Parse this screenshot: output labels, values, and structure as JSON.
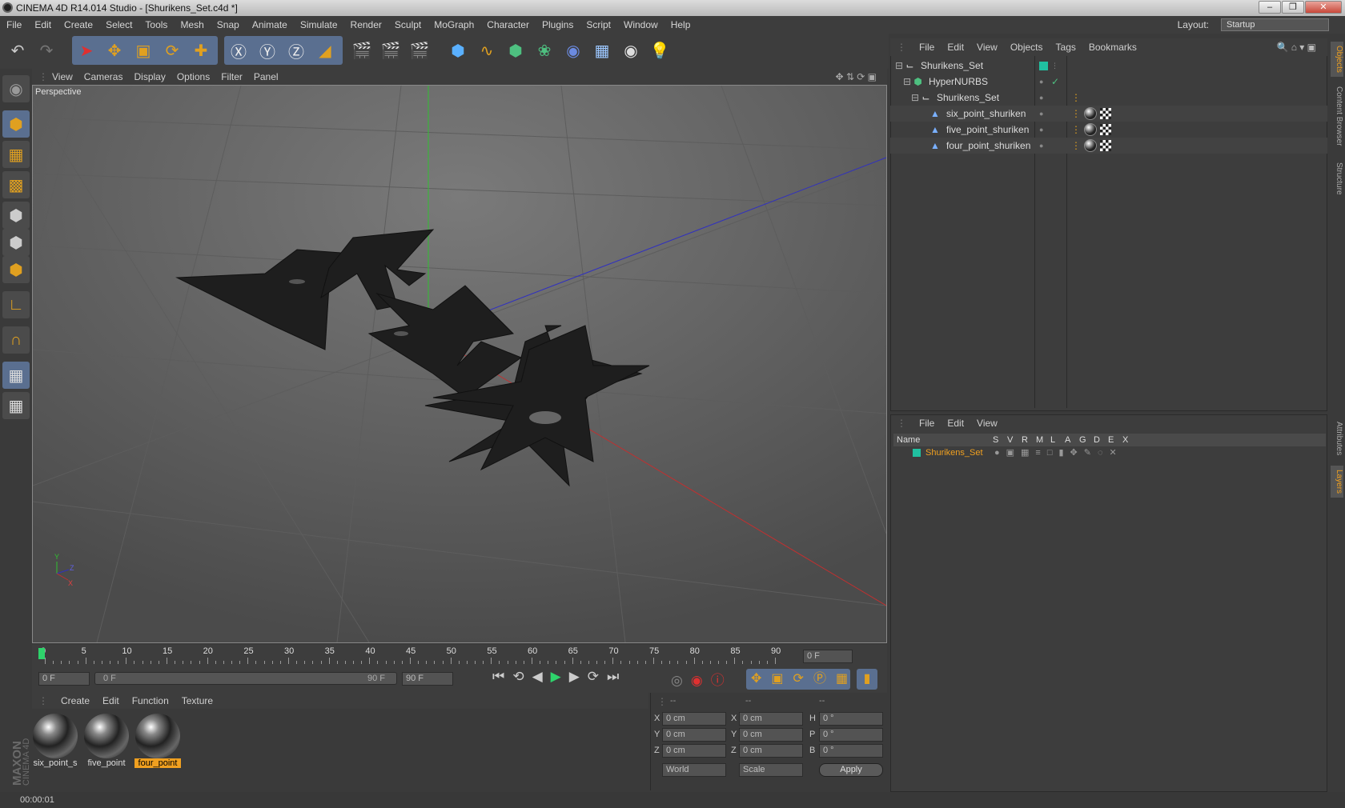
{
  "window": {
    "title": "CINEMA 4D R14.014 Studio - [Shurikens_Set.c4d *]"
  },
  "menu": {
    "items": [
      "File",
      "Edit",
      "Create",
      "Select",
      "Tools",
      "Mesh",
      "Snap",
      "Animate",
      "Simulate",
      "Render",
      "Sculpt",
      "MoGraph",
      "Character",
      "Plugins",
      "Script",
      "Window",
      "Help"
    ],
    "layout_label": "Layout:",
    "layout_value": "Startup"
  },
  "viewport": {
    "menu": [
      "View",
      "Cameras",
      "Display",
      "Options",
      "Filter",
      "Panel"
    ],
    "label": "Perspective"
  },
  "timeline": {
    "ticks": [
      "0",
      "5",
      "10",
      "15",
      "20",
      "25",
      "30",
      "35",
      "40",
      "45",
      "50",
      "55",
      "60",
      "65",
      "70",
      "75",
      "80",
      "85",
      "90"
    ],
    "current": "0 F"
  },
  "transport": {
    "start": "0 F",
    "range_start": "0 F",
    "range_end": "90 F",
    "end": "90 F"
  },
  "materials": {
    "menu": [
      "Create",
      "Edit",
      "Function",
      "Texture"
    ],
    "items": [
      {
        "name": "six_point_s"
      },
      {
        "name": "five_point"
      },
      {
        "name": "four_point"
      }
    ]
  },
  "coords": {
    "headers": [
      "--",
      "--",
      "--"
    ],
    "rows": [
      {
        "axis": "X",
        "pos": "0 cm",
        "axis2": "X",
        "size": "0 cm",
        "rotlbl": "H",
        "rot": "0 °"
      },
      {
        "axis": "Y",
        "pos": "0 cm",
        "axis2": "Y",
        "size": "0 cm",
        "rotlbl": "P",
        "rot": "0 °"
      },
      {
        "axis": "Z",
        "pos": "0 cm",
        "axis2": "Z",
        "size": "0 cm",
        "rotlbl": "B",
        "rot": "0 °"
      }
    ],
    "mode": "World",
    "scale": "Scale",
    "apply": "Apply"
  },
  "objects": {
    "menu": [
      "File",
      "Edit",
      "View",
      "Objects",
      "Tags",
      "Bookmarks"
    ],
    "tree": [
      {
        "name": "Shurikens_Set"
      },
      {
        "name": "HyperNURBS"
      },
      {
        "name": "Shurikens_Set"
      },
      {
        "name": "six_point_shuriken"
      },
      {
        "name": "five_point_shuriken"
      },
      {
        "name": "four_point_shuriken"
      }
    ]
  },
  "layers": {
    "menu": [
      "File",
      "Edit",
      "View"
    ],
    "columns": [
      "Name",
      "S",
      "V",
      "R",
      "M",
      "L",
      "A",
      "G",
      "D",
      "E",
      "X"
    ],
    "row": "Shurikens_Set"
  },
  "sidetabs": [
    "Objects",
    "Content Browser",
    "Structure",
    "Attributes",
    "Layers"
  ],
  "status": {
    "time": "00:00:01"
  },
  "colors": {
    "accent": "#f0a020",
    "layer": "#20c0a0",
    "bg": "#3d3d3d"
  }
}
